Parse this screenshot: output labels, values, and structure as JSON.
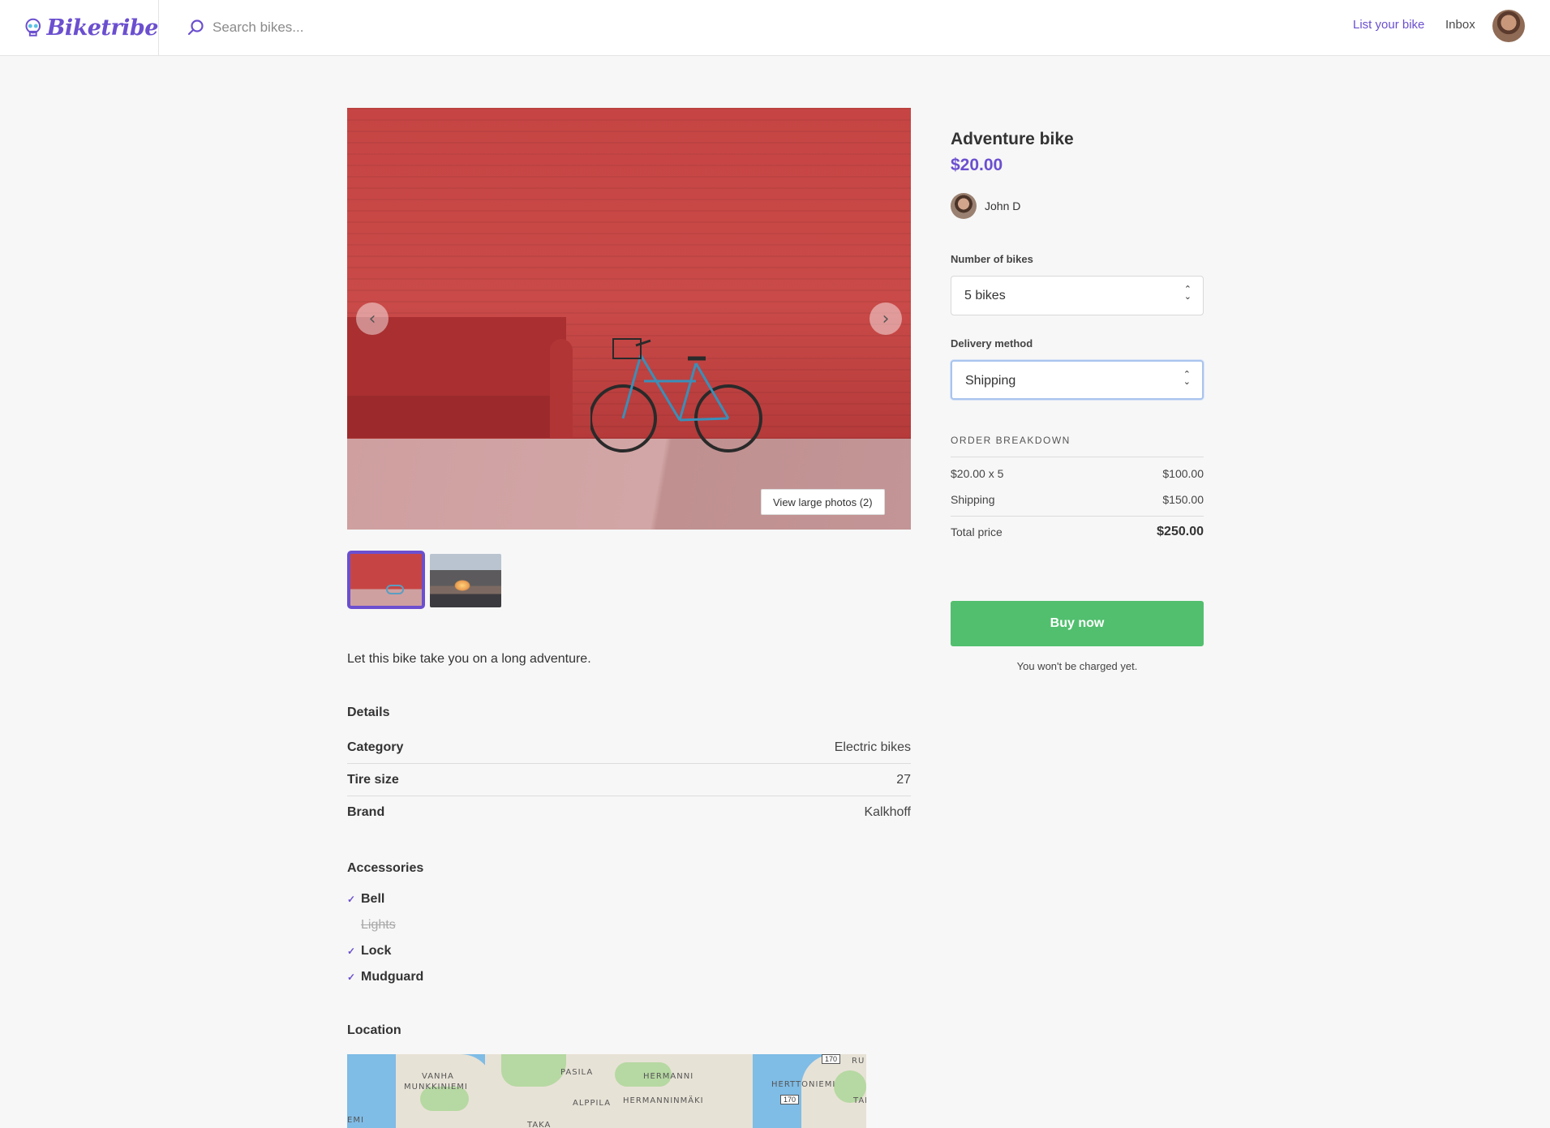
{
  "header": {
    "brand": "Biketribe",
    "search_placeholder": "Search bikes...",
    "list_bike": "List your bike",
    "inbox": "Inbox"
  },
  "gallery": {
    "view_photos": "View large photos (2)",
    "thumbnail_count": 2,
    "selected_thumbnail": 1
  },
  "listing": {
    "description": "Let this bike take you on a long adventure.",
    "details_heading": "Details",
    "details": [
      {
        "key": "Category",
        "value": "Electric bikes"
      },
      {
        "key": "Tire size",
        "value": "27"
      },
      {
        "key": "Brand",
        "value": "Kalkhoff"
      }
    ],
    "accessories_heading": "Accessories",
    "accessories": [
      {
        "label": "Bell",
        "included": true
      },
      {
        "label": "Lights",
        "included": false
      },
      {
        "label": "Lock",
        "included": true
      },
      {
        "label": "Mudguard",
        "included": true
      }
    ],
    "location_heading": "Location",
    "map_labels": [
      "VANHA",
      "MUNKKINIEMI",
      "PASILA",
      "HERMANNI",
      "ALPPILA",
      "HERMANNINMÄKI",
      "HERTTONIEMI",
      "EMI",
      "TAKA",
      "RU",
      "TAM"
    ],
    "road_shields": [
      "170",
      "170"
    ]
  },
  "order": {
    "title": "Adventure bike",
    "price": "$20.00",
    "seller": "John D",
    "bikes_label": "Number of bikes",
    "bikes_value": "5 bikes",
    "delivery_label": "Delivery method",
    "delivery_value": "Shipping",
    "breakdown_title": "ORDER BREAKDOWN",
    "line_item_label": "$20.00 x 5",
    "line_item_value": "$100.00",
    "shipping_label": "Shipping",
    "shipping_value": "$150.00",
    "total_label": "Total price",
    "total_value": "$250.00",
    "buy_label": "Buy now",
    "note": "You won't be charged yet."
  },
  "colors": {
    "brand": "#6b4fcf",
    "buy_button": "#52bf6e",
    "focus_ring": "#a9c4ee"
  }
}
